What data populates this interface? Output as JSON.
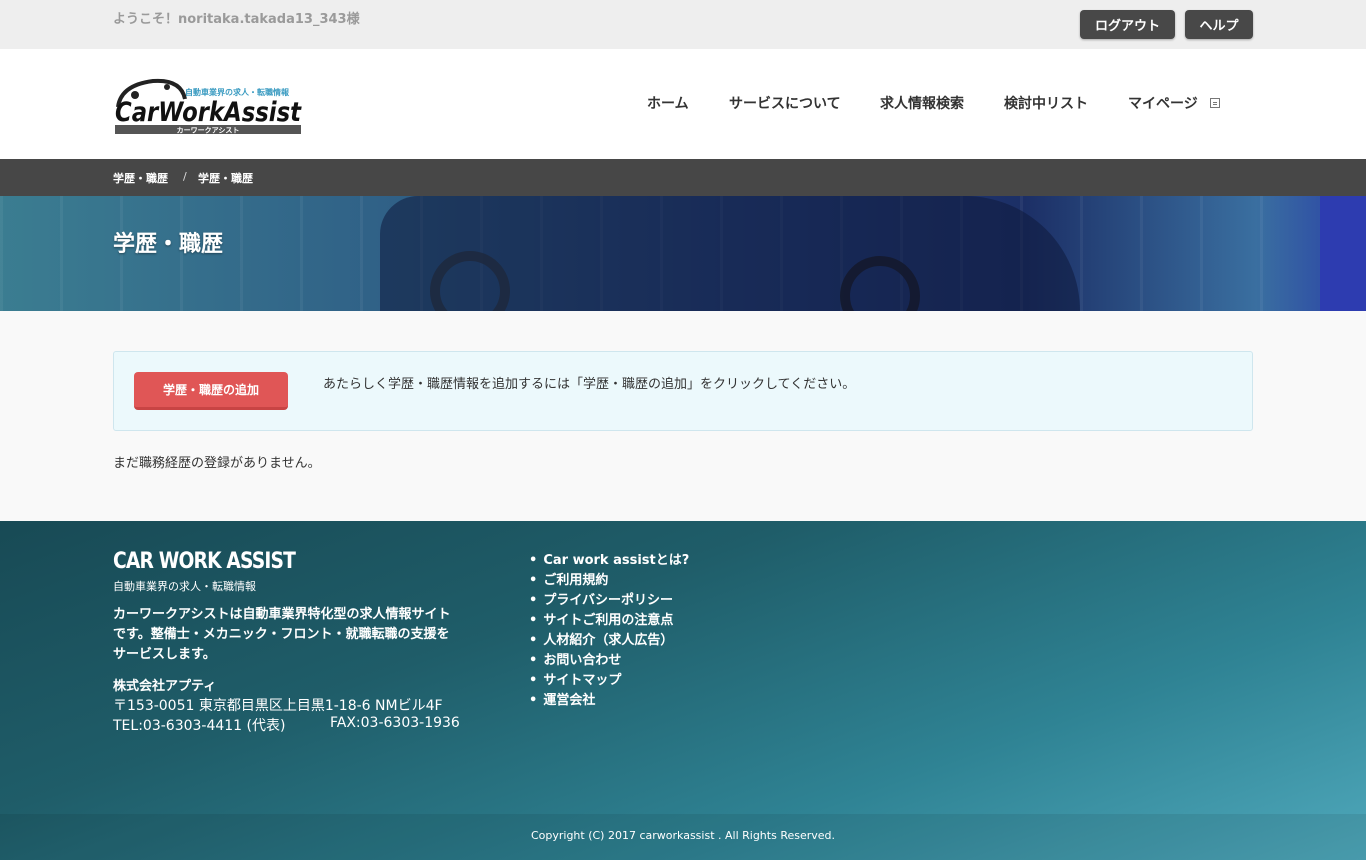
{
  "topbar": {
    "welcome": "ようこそ！noritaka.takada13_343様",
    "logout_label": "ログアウト",
    "help_label": "ヘルプ"
  },
  "header": {
    "logo": {
      "tagline": "自動車業界の求人・転職情報",
      "wordmark": "CarWorkAssist",
      "kana": "カーワークアシスト"
    },
    "nav": [
      {
        "label": "ホーム"
      },
      {
        "label": "サービスについて"
      },
      {
        "label": "求人情報検索"
      },
      {
        "label": "検討中リスト"
      },
      {
        "label": "マイページ",
        "icon": "external-link-icon"
      }
    ]
  },
  "breadcrumb": {
    "items": [
      "学歴・職歴",
      "学歴・職歴"
    ],
    "separator": "/"
  },
  "hero": {
    "title": "学歴・職歴"
  },
  "content": {
    "add_button_label": "学歴・職歴の追加",
    "info_text": "あたらしく学歴・職歴情報を追加するには「学歴・職歴の追加」をクリックしてください。",
    "empty_text": "まだ職務経歴の登録がありません。"
  },
  "footer": {
    "brand": "CAR WORK ASSIST",
    "brand_sub": "自動車業界の求人・転職情報",
    "description": "カーワークアシストは自動車業界特化型の求人情報サイトです。整備士・メカニック・フロント・就職転職の支援をサービスします。",
    "company": "株式会社アプティ",
    "address": "〒153-0051 東京都目黒区上目黒1-18-6 NMビル4F",
    "tel": "TEL:03-6303-4411 (代表)",
    "fax": "FAX:03-6303-1936",
    "links": [
      "Car work assistとは?",
      "ご利用規約",
      "プライバシーポリシー",
      "サイトご利用の注意点",
      "人材紹介（求人広告）",
      "お問い合わせ",
      "サイトマップ",
      "運営会社"
    ],
    "copyright": "Copyright (C) 2017 carworkassist . All Rights Reserved."
  },
  "colors": {
    "add_button": "#e05656",
    "breadcrumb_bar": "#474747",
    "footer_start": "#184a55",
    "footer_end": "#4fa8bb",
    "info_box": "#ecf9fc",
    "logo_accent": "#3a9bc1"
  }
}
